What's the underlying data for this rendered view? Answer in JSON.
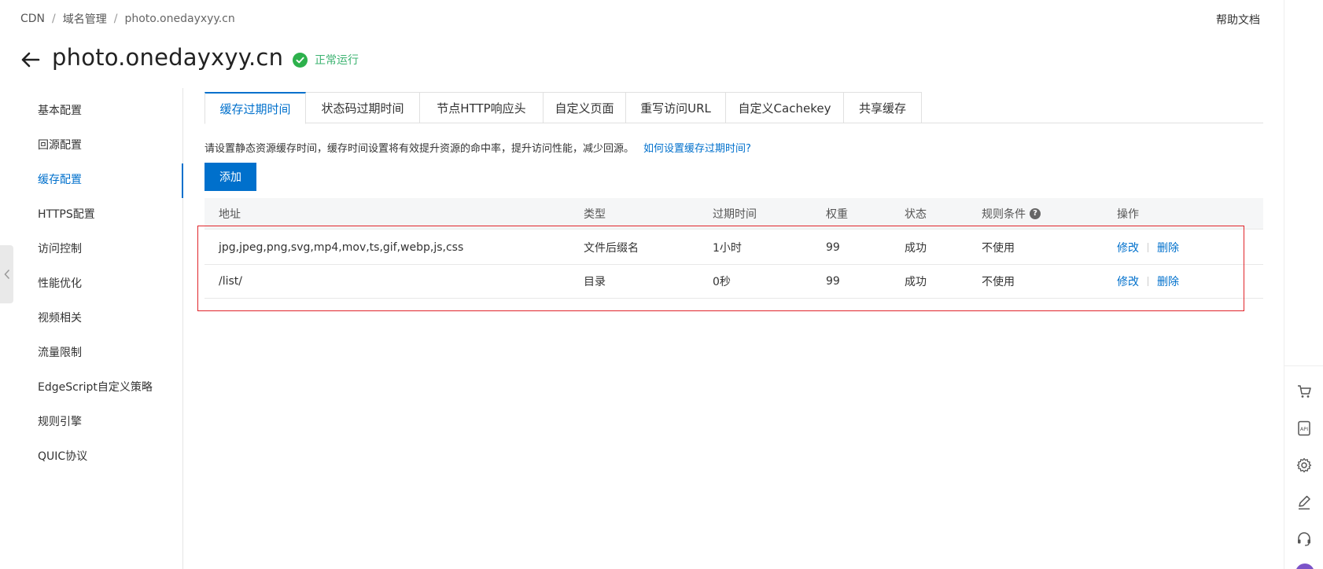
{
  "breadcrumb": [
    "CDN",
    "域名管理",
    "photo.onedayxyy.cn"
  ],
  "breadcrumb_separator": "/",
  "help_link": "帮助文档",
  "page": {
    "title": "photo.onedayxyy.cn",
    "status": "正常运行"
  },
  "sidebar": {
    "items": [
      {
        "label": "基本配置",
        "active": false
      },
      {
        "label": "回源配置",
        "active": false
      },
      {
        "label": "缓存配置",
        "active": true
      },
      {
        "label": "HTTPS配置",
        "active": false
      },
      {
        "label": "访问控制",
        "active": false
      },
      {
        "label": "性能优化",
        "active": false
      },
      {
        "label": "视频相关",
        "active": false
      },
      {
        "label": "流量限制",
        "active": false
      },
      {
        "label": "EdgeScript自定义策略",
        "active": false
      },
      {
        "label": "规则引擎",
        "active": false
      },
      {
        "label": "QUIC协议",
        "active": false
      }
    ]
  },
  "tabs": [
    {
      "label": "缓存过期时间",
      "active": true
    },
    {
      "label": "状态码过期时间",
      "active": false
    },
    {
      "label": "节点HTTP响应头",
      "active": false
    },
    {
      "label": "自定义页面",
      "active": false
    },
    {
      "label": "重写访问URL",
      "active": false
    },
    {
      "label": "自定义Cachekey",
      "active": false
    },
    {
      "label": "共享缓存",
      "active": false
    }
  ],
  "description": {
    "text": "请设置静态资源缓存时间，缓存时间设置将有效提升资源的命中率，提升访问性能，减少回源。",
    "link": "如何设置缓存过期时间?"
  },
  "add_button": "添加",
  "table": {
    "headers": {
      "address": "地址",
      "type": "类型",
      "ttl": "过期时间",
      "weight": "权重",
      "state": "状态",
      "condition": "规则条件",
      "ops": "操作"
    },
    "condition_help_icon": "?",
    "rows": [
      {
        "address": "jpg,jpeg,png,svg,mp4,mov,ts,gif,webp,js,css",
        "type": "文件后缀名",
        "ttl": "1小时",
        "weight": "99",
        "state": "成功",
        "condition": "不使用",
        "edit": "修改",
        "delete": "删除"
      },
      {
        "address": "/list/",
        "type": "目录",
        "ttl": "0秒",
        "weight": "99",
        "state": "成功",
        "condition": "不使用",
        "edit": "修改",
        "delete": "删除"
      }
    ]
  },
  "right_toolbar": {
    "icons": [
      "cart-icon",
      "api-icon",
      "gear-icon",
      "edit-icon",
      "headset-icon"
    ]
  },
  "colors": {
    "accent": "#0070cc",
    "status_green": "#2db14c",
    "highlight_red": "#e0242a"
  }
}
